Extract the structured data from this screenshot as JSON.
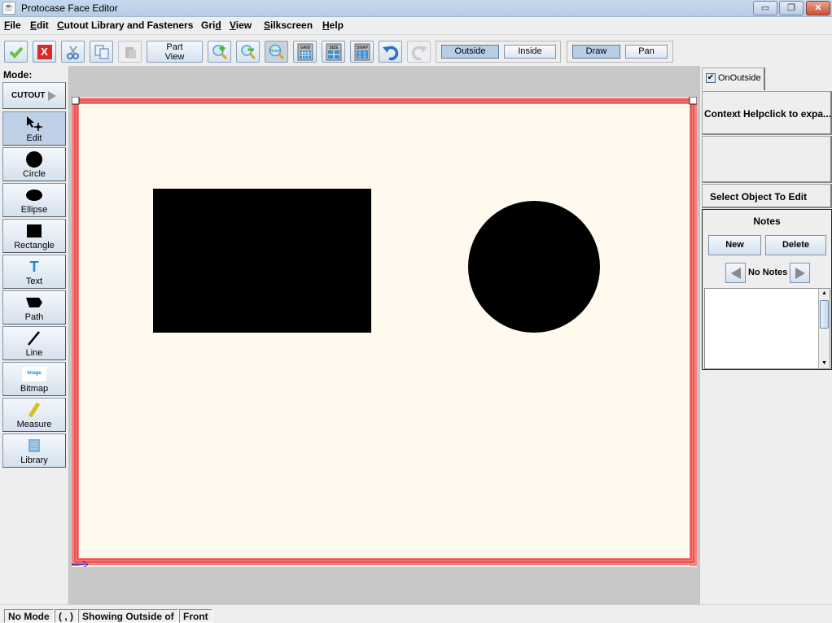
{
  "window": {
    "title": "Protocase Face Editor",
    "controls": {
      "minimize": "▭",
      "restore": "❐",
      "close": "✕"
    }
  },
  "menubar": {
    "items": [
      {
        "label_u": "F",
        "label_rest": "ile"
      },
      {
        "label_u": "E",
        "label_rest": "dit"
      },
      {
        "label_u": "C",
        "label_rest": "utout Library and Fasteners"
      },
      {
        "label_pre": "Gri",
        "label_u": "d"
      },
      {
        "label_u": "V",
        "label_rest": "iew"
      },
      {
        "label_u": "S",
        "label_rest": "ilkscreen"
      },
      {
        "label_u": "H",
        "label_rest": "elp"
      }
    ]
  },
  "toolbar": {
    "accept_icon": "check-icon",
    "cancel_icon": "x-icon",
    "part_view_line1": "Part",
    "part_view_line2": "View",
    "grid_label": "GRID",
    "size_label": "SIZE",
    "snap_label": "SNAP",
    "reset_label": "Reset",
    "side_group": {
      "outside": "Outside",
      "inside": "Inside",
      "active": "Outside"
    },
    "tool_group": {
      "draw": "Draw",
      "pan": "Pan",
      "active": "Draw"
    }
  },
  "leftpanel": {
    "mode_label": "Mode:",
    "cutout_label": "CUTOUT",
    "modes": [
      {
        "label": "Edit",
        "icon": "edit-pointer-icon",
        "active": true
      },
      {
        "label": "Circle",
        "icon": "circle-icon"
      },
      {
        "label": "Ellipse",
        "icon": "ellipse-icon"
      },
      {
        "label": "Rectangle",
        "icon": "rectangle-icon"
      },
      {
        "label": "Text",
        "icon": "text-icon"
      },
      {
        "label": "Path",
        "icon": "path-icon"
      },
      {
        "label": "Line",
        "icon": "line-icon"
      },
      {
        "label": "Bitmap",
        "icon": "bitmap-icon",
        "icon_text": "Image"
      },
      {
        "label": "Measure",
        "icon": "measure-icon"
      },
      {
        "label": "Library",
        "icon": "library-icon"
      }
    ]
  },
  "canvas": {
    "board_color": "#fff9ee",
    "border_color": "#ff7f7f",
    "shapes": [
      {
        "type": "rectangle",
        "fill": "#000000"
      },
      {
        "type": "circle",
        "fill": "#000000"
      }
    ]
  },
  "rightpanel": {
    "tab_label": "OnOutside",
    "tab_checked": "✔",
    "context_help": "Context Helpclick to expa...",
    "select_object": "Select Object To Edit",
    "notes": {
      "title": "Notes",
      "new_label": "New",
      "delete_label": "Delete",
      "nav_label": "No Notes",
      "text": ""
    }
  },
  "statusbar": {
    "mode": "No Mode",
    "coords": "( , )",
    "showing": "Showing Outside of",
    "face": "Front"
  }
}
